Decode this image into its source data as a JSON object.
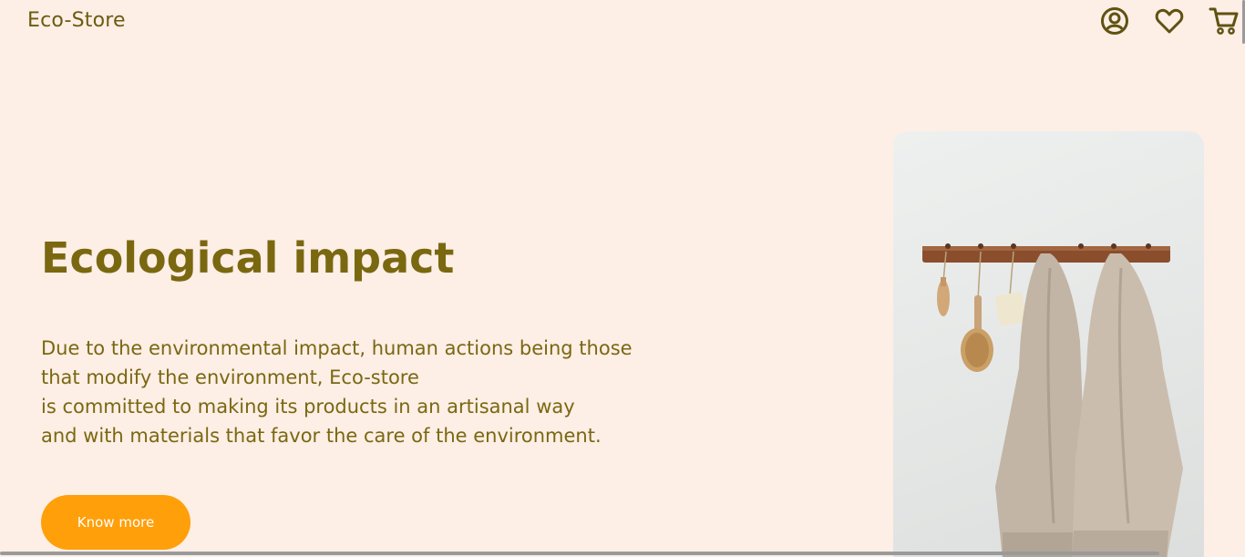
{
  "header": {
    "brand": "Eco-Store",
    "icons": [
      "user-circle-icon",
      "heart-icon",
      "cart-icon"
    ]
  },
  "hero": {
    "title": "Ecological impact",
    "paragraph_lines": [
      "Due to the environmental impact, human actions being those",
      "that modify the environment, Eco-store",
      "is committed to making its products in an artisanal way",
      "and with materials that favor the care of the environment."
    ],
    "button_label": "Know more"
  },
  "colors": {
    "background": "#fdeee6",
    "text_olive": "#7a6810",
    "button_orange": "#ff9f0a"
  }
}
